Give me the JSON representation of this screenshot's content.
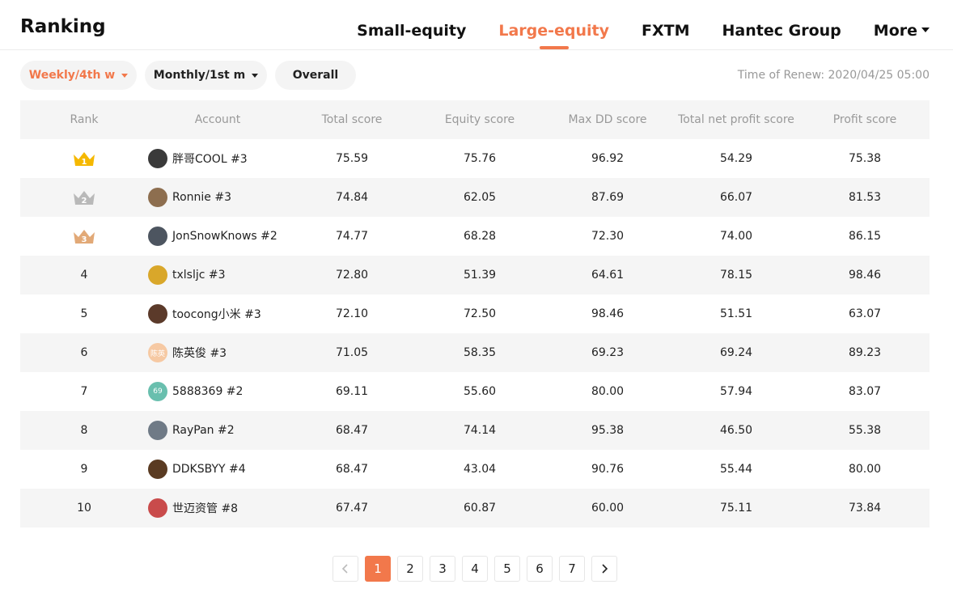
{
  "header": {
    "title": "Ranking",
    "nav": [
      {
        "label": "Small-equity",
        "active": false
      },
      {
        "label": "Large-equity",
        "active": true
      },
      {
        "label": "FXTM",
        "active": false
      },
      {
        "label": "Hantec Group",
        "active": false
      },
      {
        "label": "More",
        "active": false
      }
    ]
  },
  "filters": {
    "weekly": "Weekly/4th w",
    "monthly": "Monthly/1st m",
    "overall": "Overall"
  },
  "renew_text": "Time of Renew: 2020/04/25 05:00",
  "colors": {
    "accent": "#f2784b",
    "gold": "#f5b800",
    "silver": "#b9b9b9",
    "bronze": "#e2a977"
  },
  "table": {
    "headers": [
      "Rank",
      "Account",
      "Total score",
      "Equity score",
      "Max DD score",
      "Total net profit score",
      "Profit score"
    ],
    "rows": [
      {
        "rank": "1",
        "account": "胖哥COOL #3",
        "total": "75.59",
        "equity": "75.76",
        "maxdd": "96.92",
        "netprofit": "54.29",
        "profit": "75.38",
        "avatar_color": "#3a3a3a",
        "avatar_text": ""
      },
      {
        "rank": "2",
        "account": "Ronnie #3",
        "total": "74.84",
        "equity": "62.05",
        "maxdd": "87.69",
        "netprofit": "66.07",
        "profit": "81.53",
        "avatar_color": "#8d6e4f",
        "avatar_text": ""
      },
      {
        "rank": "3",
        "account": "JonSnowKnows #2",
        "total": "74.77",
        "equity": "68.28",
        "maxdd": "72.30",
        "netprofit": "74.00",
        "profit": "86.15",
        "avatar_color": "#4d5560",
        "avatar_text": ""
      },
      {
        "rank": "4",
        "account": "txlsljc #3",
        "total": "72.80",
        "equity": "51.39",
        "maxdd": "64.61",
        "netprofit": "78.15",
        "profit": "98.46",
        "avatar_color": "#d9a72a",
        "avatar_text": ""
      },
      {
        "rank": "5",
        "account": "toocong小米 #3",
        "total": "72.10",
        "equity": "72.50",
        "maxdd": "98.46",
        "netprofit": "51.51",
        "profit": "63.07",
        "avatar_color": "#5b3a2a",
        "avatar_text": ""
      },
      {
        "rank": "6",
        "account": "陈英俊 #3",
        "total": "71.05",
        "equity": "58.35",
        "maxdd": "69.23",
        "netprofit": "69.24",
        "profit": "89.23",
        "avatar_color": "#f6c9a3",
        "avatar_text": "陈英"
      },
      {
        "rank": "7",
        "account": "5888369 #2",
        "total": "69.11",
        "equity": "55.60",
        "maxdd": "80.00",
        "netprofit": "57.94",
        "profit": "83.07",
        "avatar_color": "#69bfae",
        "avatar_text": "69"
      },
      {
        "rank": "8",
        "account": "RayPan #2",
        "total": "68.47",
        "equity": "74.14",
        "maxdd": "95.38",
        "netprofit": "46.50",
        "profit": "55.38",
        "avatar_color": "#6f7a86",
        "avatar_text": ""
      },
      {
        "rank": "9",
        "account": "DDKSBYY #4",
        "total": "68.47",
        "equity": "43.04",
        "maxdd": "90.76",
        "netprofit": "55.44",
        "profit": "80.00",
        "avatar_color": "#5a3b22",
        "avatar_text": ""
      },
      {
        "rank": "10",
        "account": "世迈资管 #8",
        "total": "67.47",
        "equity": "60.87",
        "maxdd": "60.00",
        "netprofit": "75.11",
        "profit": "73.84",
        "avatar_color": "#c94b4b",
        "avatar_text": ""
      }
    ]
  },
  "pagination": {
    "prev_icon": "chevron-left-icon",
    "next_icon": "chevron-right-icon",
    "pages": [
      "1",
      "2",
      "3",
      "4",
      "5",
      "6",
      "7"
    ],
    "current": "1"
  }
}
